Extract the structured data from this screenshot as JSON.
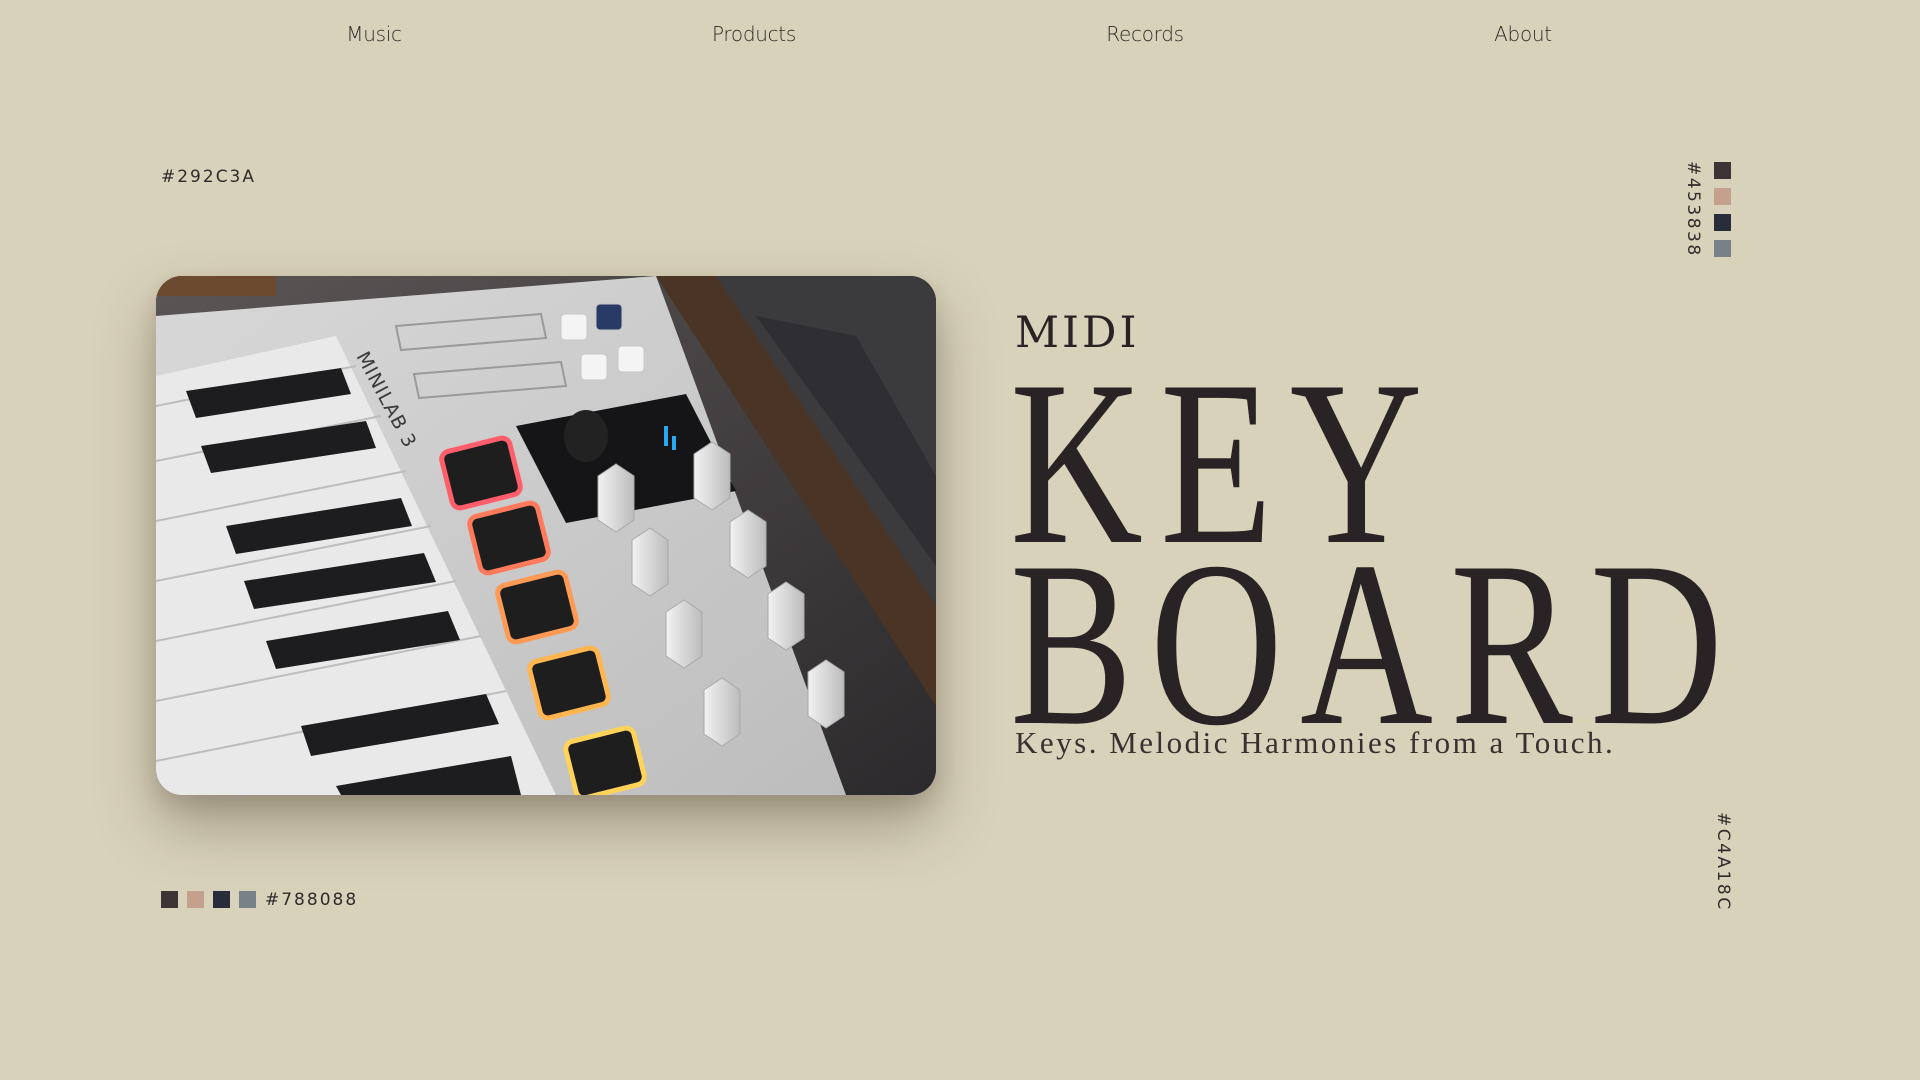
{
  "nav": {
    "items": [
      "Music",
      "Products",
      "Records",
      "About"
    ]
  },
  "palette": {
    "labels": {
      "top_left": "#292C3A",
      "bottom_left": "#788088",
      "right_top": "#453838",
      "right_bottom": "#C4A18C"
    },
    "swatches": [
      "#3D3436",
      "#C4A18C",
      "#292C3A",
      "#788088"
    ]
  },
  "hero": {
    "eyebrow": "MIDI",
    "title_line_1": "KEY",
    "title_line_2": "BOARD",
    "tagline": "Keys. Melodic Harmonies from a Touch."
  },
  "photo": {
    "device_label": "MINILAB 3"
  }
}
